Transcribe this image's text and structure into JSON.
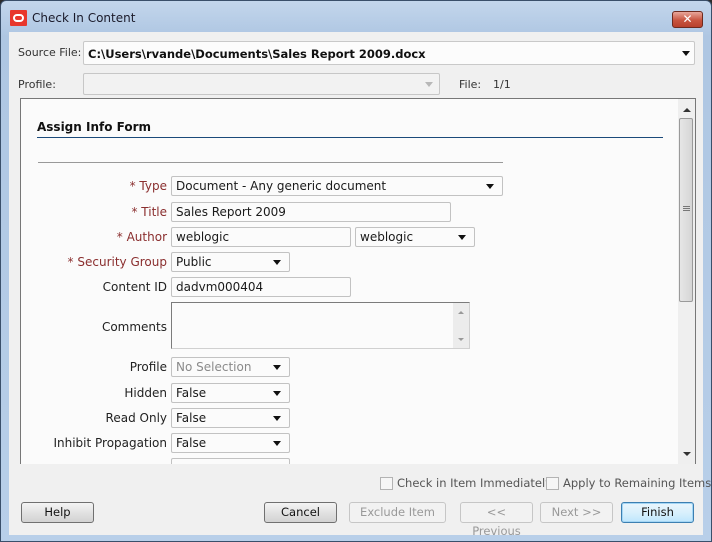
{
  "window": {
    "title": "Check In Content",
    "close_label": "✕"
  },
  "header": {
    "source_file_label": "Source File:",
    "source_file_value": "C:\\Users\\rvande\\Documents\\Sales Report 2009.docx",
    "profile_label": "Profile:",
    "profile_value": "",
    "file_label": "File:",
    "file_value": "1/1"
  },
  "form": {
    "heading": "Assign Info Form",
    "fields": {
      "type": {
        "label": "* Type",
        "value": "Document - Any generic document",
        "required": true
      },
      "title": {
        "label": "* Title",
        "value": "Sales Report 2009",
        "required": true
      },
      "author": {
        "label": "* Author",
        "value": "weblogic",
        "select_value": "weblogic",
        "required": true
      },
      "security_group": {
        "label": "* Security Group",
        "value": "Public",
        "required": true
      },
      "content_id": {
        "label": "Content ID",
        "value": "dadvm000404"
      },
      "comments": {
        "label": "Comments",
        "value": ""
      },
      "profile": {
        "label": "Profile",
        "value": "No Selection",
        "disabled": true
      },
      "hidden": {
        "label": "Hidden",
        "value": "False"
      },
      "read_only": {
        "label": "Read Only",
        "value": "False"
      },
      "inhibit_propagation": {
        "label": "Inhibit Propagation",
        "value": "False"
      }
    }
  },
  "options": {
    "check_in_immediately": {
      "label": "Check in Item Immediately",
      "checked": false
    },
    "apply_remaining": {
      "label": "Apply to Remaining Items",
      "checked": false
    }
  },
  "buttons": {
    "help": "Help",
    "cancel": "Cancel",
    "exclude": "Exclude Item",
    "previous": "<< Previous",
    "next": "Next >>",
    "finish": "Finish"
  }
}
